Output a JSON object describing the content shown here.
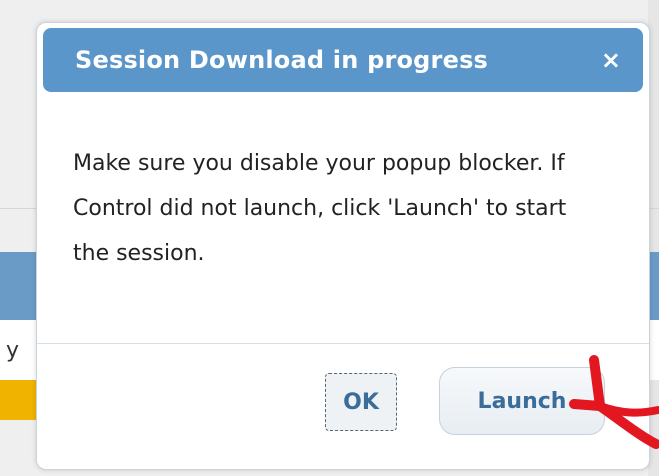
{
  "background": {
    "fragment_text": "y"
  },
  "dialog": {
    "title": "Session Download in progress",
    "close_icon": "×",
    "message": "Make sure you disable your popup blocker. If Control did not launch, click 'Launch' to start the session.",
    "buttons": {
      "ok_label": "OK",
      "launch_label": "Launch"
    }
  },
  "colors": {
    "header_bg": "#5a96c9",
    "button_text": "#3b6d9a",
    "annotation_arrow": "#e3171f"
  }
}
